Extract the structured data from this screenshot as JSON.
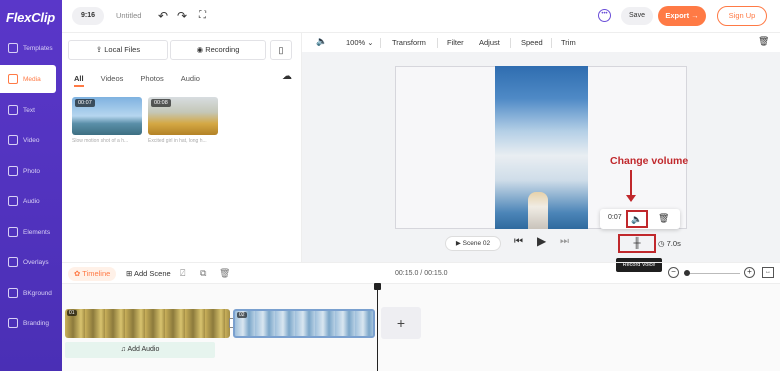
{
  "app": {
    "logo": "FlexClip"
  },
  "sidebar": {
    "items": [
      {
        "label": "Templates",
        "icon": "templates-icon"
      },
      {
        "label": "Media",
        "icon": "media-icon",
        "active": true
      },
      {
        "label": "Text",
        "icon": "text-icon"
      },
      {
        "label": "Video",
        "icon": "video-icon"
      },
      {
        "label": "Photo",
        "icon": "photo-icon"
      },
      {
        "label": "Audio",
        "icon": "audio-icon"
      },
      {
        "label": "Elements",
        "icon": "elements-icon"
      },
      {
        "label": "Overlays",
        "icon": "overlays-icon"
      },
      {
        "label": "BKground",
        "icon": "background-icon"
      },
      {
        "label": "Branding",
        "icon": "branding-icon"
      }
    ]
  },
  "topbar": {
    "ratio": "9:16",
    "title": "Untitled",
    "save": "Save",
    "export": "Export →",
    "signup": "Sign Up"
  },
  "media": {
    "local_files": "Local Files",
    "recording": "Recording",
    "tabs": [
      "All",
      "Videos",
      "Photos",
      "Audio"
    ],
    "items": [
      {
        "duration": "00:07",
        "caption": "Slow motion shot of a h..."
      },
      {
        "duration": "00:08",
        "caption": "Excited girl in hat, long h..."
      }
    ]
  },
  "preview_toolbar": {
    "zoom": "100%",
    "tools": [
      "Transform",
      "Filter",
      "Adjust",
      "Speed",
      "Trim"
    ]
  },
  "preview": {
    "scene_label": "Scene 02",
    "popup_time": "0:07",
    "annotation": "Change volume",
    "tooltip": "Record Voice",
    "duration": "7.0s"
  },
  "timeline": {
    "label": "Timeline",
    "add_scene": "Add Scene",
    "time": "00:15.0 / 00:15.0",
    "clip1_num": "01",
    "clip2_num": "02",
    "add_audio": "Add Audio"
  },
  "colors": {
    "brand_purple": "#5a37c9",
    "accent_orange": "#ff7a45",
    "annotation_red": "#c0282c"
  }
}
